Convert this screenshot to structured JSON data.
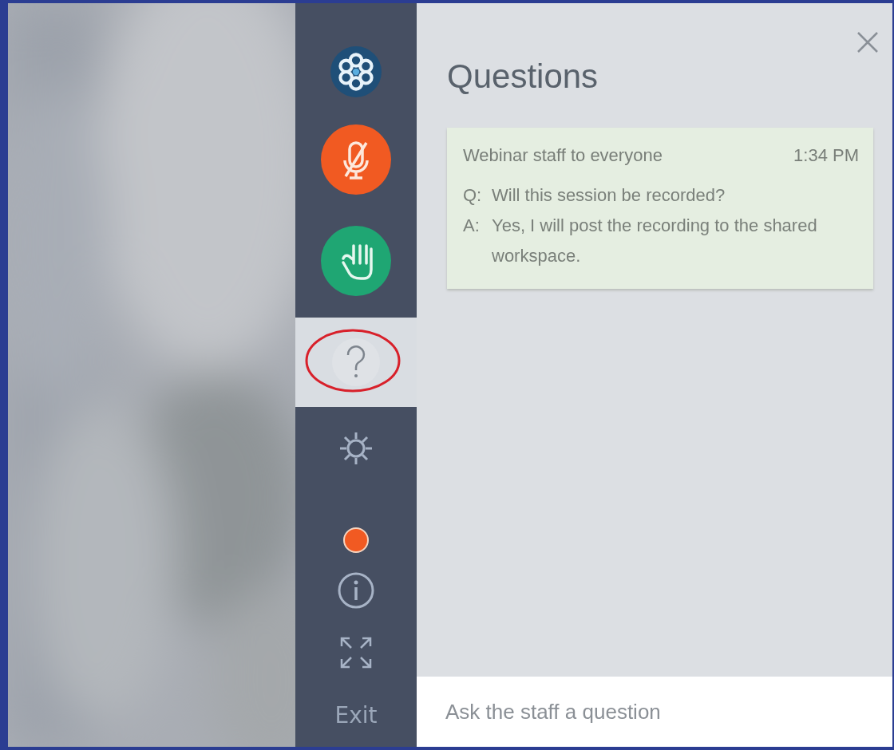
{
  "sidebar": {
    "items": [
      {
        "kind": "logo",
        "selected": false,
        "annotated": false
      },
      {
        "kind": "mute",
        "selected": false,
        "annotated": false
      },
      {
        "kind": "hand",
        "selected": false,
        "annotated": false
      },
      {
        "kind": "question",
        "selected": true,
        "annotated": true
      },
      {
        "kind": "settings",
        "selected": false,
        "annotated": false
      },
      {
        "kind": "record",
        "selected": false,
        "annotated": false
      },
      {
        "kind": "info",
        "selected": false,
        "annotated": false
      },
      {
        "kind": "expand",
        "selected": false,
        "annotated": false
      },
      {
        "kind": "exit",
        "label": "Exit",
        "selected": false,
        "annotated": false
      }
    ]
  },
  "panel": {
    "title": "Questions",
    "messages": [
      {
        "sender": "Webinar staff to everyone",
        "time": "1:34 PM",
        "lines": [
          {
            "prefix": "Q:",
            "text": "Will this session be recorded?"
          },
          {
            "prefix": "A:",
            "text": "Yes, I will post the recording to the shared workspace."
          }
        ]
      }
    ],
    "input": {
      "placeholder": "Ask the staff a question"
    }
  }
}
